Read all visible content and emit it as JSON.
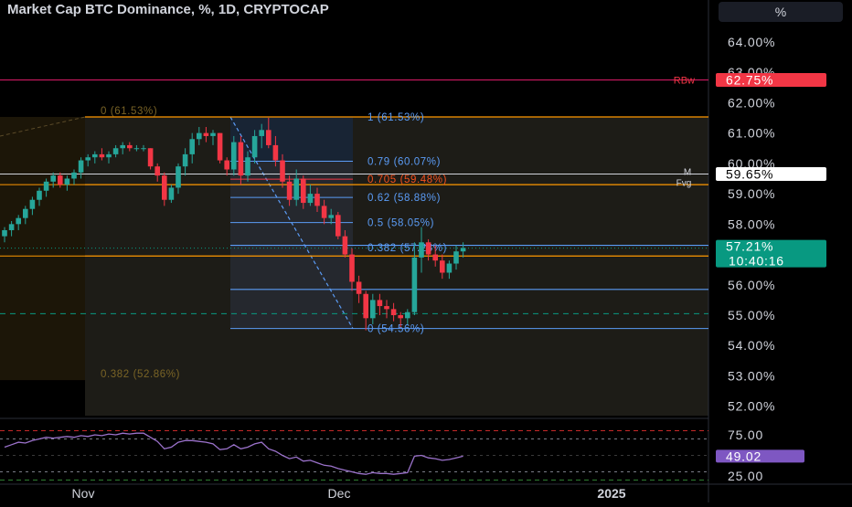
{
  "header": {
    "title": "Market Cap BTC Dominance, %, 1D, CRYPTOCAP",
    "unit_button": "%"
  },
  "colors": {
    "up": "#26a69a",
    "down": "#f23645",
    "fib_blue": "#5b9cf6",
    "fib_orange": "#ff9800",
    "resistance_red": "#c2185b",
    "rsi_line": "#9b72cb",
    "price_tag": "#089981",
    "rsi_tag": "#7e57c2",
    "rbw_tag": "#f23645"
  },
  "chart_data": [
    {
      "type": "candlestick",
      "symbol": "Market Cap BTC Dominance",
      "interval": "1D",
      "ylim": [
        51.6,
        64.6
      ],
      "y_ticks": [
        "64.00%",
        "63.00%",
        "62.00%",
        "61.00%",
        "60.00%",
        "59.00%",
        "58.00%",
        "57.00%",
        "56.00%",
        "55.00%",
        "54.00%",
        "53.00%",
        "52.00%"
      ],
      "x_ticks": [
        "Nov",
        "Dec",
        "2025"
      ],
      "candles": [
        {
          "o": 57.6,
          "h": 57.9,
          "l": 57.4,
          "c": 57.8
        },
        {
          "o": 57.8,
          "h": 58.1,
          "l": 57.6,
          "c": 58.0
        },
        {
          "o": 58.0,
          "h": 58.3,
          "l": 57.8,
          "c": 58.2
        },
        {
          "o": 58.2,
          "h": 58.6,
          "l": 58.0,
          "c": 58.5
        },
        {
          "o": 58.5,
          "h": 58.9,
          "l": 58.3,
          "c": 58.8
        },
        {
          "o": 58.8,
          "h": 59.2,
          "l": 58.6,
          "c": 59.1
        },
        {
          "o": 59.1,
          "h": 59.5,
          "l": 58.9,
          "c": 59.4
        },
        {
          "o": 59.4,
          "h": 59.7,
          "l": 59.2,
          "c": 59.6
        },
        {
          "o": 59.6,
          "h": 59.7,
          "l": 59.2,
          "c": 59.3
        },
        {
          "o": 59.3,
          "h": 59.6,
          "l": 59.1,
          "c": 59.5
        },
        {
          "o": 59.5,
          "h": 59.8,
          "l": 59.3,
          "c": 59.7
        },
        {
          "o": 59.7,
          "h": 60.2,
          "l": 59.5,
          "c": 60.1
        },
        {
          "o": 60.1,
          "h": 60.3,
          "l": 59.9,
          "c": 60.2
        },
        {
          "o": 60.2,
          "h": 60.4,
          "l": 60.0,
          "c": 60.3
        },
        {
          "o": 60.3,
          "h": 60.5,
          "l": 60.1,
          "c": 60.2
        },
        {
          "o": 60.2,
          "h": 60.4,
          "l": 60.0,
          "c": 60.3
        },
        {
          "o": 60.3,
          "h": 60.6,
          "l": 60.2,
          "c": 60.5
        },
        {
          "o": 60.5,
          "h": 60.7,
          "l": 60.3,
          "c": 60.6
        },
        {
          "o": 60.6,
          "h": 60.7,
          "l": 60.4,
          "c": 60.5
        },
        {
          "o": 60.5,
          "h": 60.6,
          "l": 60.4,
          "c": 60.5
        },
        {
          "o": 60.5,
          "h": 60.6,
          "l": 60.4,
          "c": 60.5
        },
        {
          "o": 60.5,
          "h": 60.5,
          "l": 59.8,
          "c": 59.9
        },
        {
          "o": 59.9,
          "h": 60.0,
          "l": 59.4,
          "c": 59.6
        },
        {
          "o": 59.6,
          "h": 59.7,
          "l": 58.6,
          "c": 58.8
        },
        {
          "o": 58.8,
          "h": 59.3,
          "l": 58.7,
          "c": 59.2
        },
        {
          "o": 59.2,
          "h": 60.0,
          "l": 59.0,
          "c": 59.9
        },
        {
          "o": 59.9,
          "h": 60.5,
          "l": 59.6,
          "c": 60.3
        },
        {
          "o": 60.3,
          "h": 61.0,
          "l": 60.0,
          "c": 60.8
        },
        {
          "o": 60.8,
          "h": 61.2,
          "l": 60.6,
          "c": 61.0
        },
        {
          "o": 61.0,
          "h": 61.2,
          "l": 60.7,
          "c": 60.9
        },
        {
          "o": 60.9,
          "h": 61.1,
          "l": 60.6,
          "c": 61.0
        },
        {
          "o": 61.0,
          "h": 61.0,
          "l": 60.0,
          "c": 60.1
        },
        {
          "o": 60.1,
          "h": 60.2,
          "l": 59.6,
          "c": 59.8
        },
        {
          "o": 59.8,
          "h": 60.9,
          "l": 59.6,
          "c": 60.7
        },
        {
          "o": 60.7,
          "h": 60.9,
          "l": 59.3,
          "c": 59.6
        },
        {
          "o": 59.6,
          "h": 60.4,
          "l": 59.4,
          "c": 60.2
        },
        {
          "o": 60.2,
          "h": 61.1,
          "l": 60.0,
          "c": 60.9
        },
        {
          "o": 60.9,
          "h": 61.3,
          "l": 60.5,
          "c": 61.1
        },
        {
          "o": 61.1,
          "h": 61.5,
          "l": 60.5,
          "c": 60.6
        },
        {
          "o": 60.6,
          "h": 60.9,
          "l": 59.9,
          "c": 60.1
        },
        {
          "o": 60.1,
          "h": 60.3,
          "l": 59.2,
          "c": 59.4
        },
        {
          "o": 59.4,
          "h": 59.6,
          "l": 58.6,
          "c": 58.8
        },
        {
          "o": 58.8,
          "h": 59.8,
          "l": 58.6,
          "c": 59.5
        },
        {
          "o": 59.5,
          "h": 59.6,
          "l": 58.5,
          "c": 58.7
        },
        {
          "o": 58.7,
          "h": 59.3,
          "l": 58.6,
          "c": 59.0
        },
        {
          "o": 59.0,
          "h": 59.2,
          "l": 58.4,
          "c": 58.6
        },
        {
          "o": 58.6,
          "h": 58.8,
          "l": 58.0,
          "c": 58.2
        },
        {
          "o": 58.2,
          "h": 58.5,
          "l": 58.0,
          "c": 58.3
        },
        {
          "o": 58.3,
          "h": 58.4,
          "l": 57.5,
          "c": 57.6
        },
        {
          "o": 57.6,
          "h": 57.8,
          "l": 56.9,
          "c": 57.0
        },
        {
          "o": 57.0,
          "h": 57.2,
          "l": 55.8,
          "c": 56.1
        },
        {
          "o": 56.1,
          "h": 56.3,
          "l": 55.4,
          "c": 55.7
        },
        {
          "o": 55.7,
          "h": 55.8,
          "l": 54.5,
          "c": 54.9
        },
        {
          "o": 54.9,
          "h": 55.7,
          "l": 54.7,
          "c": 55.5
        },
        {
          "o": 55.5,
          "h": 55.7,
          "l": 55.0,
          "c": 55.3
        },
        {
          "o": 55.3,
          "h": 55.5,
          "l": 54.9,
          "c": 55.2
        },
        {
          "o": 55.2,
          "h": 55.4,
          "l": 54.8,
          "c": 55.0
        },
        {
          "o": 55.0,
          "h": 55.1,
          "l": 54.6,
          "c": 54.9
        },
        {
          "o": 54.9,
          "h": 55.2,
          "l": 54.7,
          "c": 55.1
        },
        {
          "o": 55.1,
          "h": 57.4,
          "l": 55.0,
          "c": 56.9
        },
        {
          "o": 56.9,
          "h": 57.9,
          "l": 56.4,
          "c": 57.4
        },
        {
          "o": 57.4,
          "h": 57.5,
          "l": 56.8,
          "c": 57.0
        },
        {
          "o": 57.0,
          "h": 57.3,
          "l": 56.6,
          "c": 56.8
        },
        {
          "o": 56.8,
          "h": 57.0,
          "l": 56.2,
          "c": 56.4
        },
        {
          "o": 56.4,
          "h": 56.8,
          "l": 56.2,
          "c": 56.7
        },
        {
          "o": 56.7,
          "h": 57.3,
          "l": 56.5,
          "c": 57.1
        },
        {
          "o": 57.1,
          "h": 57.4,
          "l": 56.9,
          "c": 57.21
        }
      ],
      "last_price": "57.21%",
      "countdown": "10:40:16",
      "resistance": {
        "label": "RBw",
        "value": 62.75,
        "tag": "62.75%"
      },
      "marker_level": {
        "value": 59.65,
        "tag": "59.65%",
        "labels": [
          "M",
          "Fvg"
        ]
      },
      "fib_up": [
        {
          "label": "1 (61.53%)",
          "value": 61.53
        },
        {
          "label": "0.79 (60.07%)",
          "value": 60.07
        },
        {
          "label": "0.705 (59.48%)",
          "value": 59.48
        },
        {
          "label": "0.62 (58.88%)",
          "value": 58.88
        },
        {
          "label": "0.5 (58.05%)",
          "value": 58.05
        },
        {
          "label": "0.382 (57.23%)",
          "value": 57.23
        },
        {
          "label": "0 (54.56%)",
          "value": 54.56
        }
      ],
      "fib_outer": [
        {
          "label": "0 (61.53%)",
          "value": 61.53
        },
        {
          "label": "0.382 (52.86%)",
          "value": 52.86
        }
      ],
      "orange_levels": [
        61.53,
        59.3,
        56.95
      ],
      "blue_levels": [
        57.3,
        55.85,
        54.56
      ],
      "dashed_level": 55.05
    },
    {
      "type": "line",
      "name": "RSI",
      "ylim": [
        15,
        95
      ],
      "y_ticks": [
        "75.00",
        "25.00"
      ],
      "bands": [
        80,
        70,
        50,
        30,
        20
      ],
      "last_value": "49.02",
      "values": [
        60,
        63,
        66,
        65,
        68,
        70,
        72,
        71,
        72,
        73,
        72,
        74,
        73,
        75,
        74,
        76,
        75,
        77,
        76,
        77,
        77,
        72,
        67,
        58,
        60,
        66,
        68,
        68,
        67,
        66,
        64,
        57,
        58,
        63,
        58,
        60,
        64,
        66,
        58,
        55,
        50,
        46,
        48,
        43,
        44,
        41,
        38,
        37,
        34,
        32,
        30,
        28,
        27,
        29,
        28,
        28,
        27,
        28,
        29,
        49,
        50,
        47,
        46,
        44,
        45,
        47,
        49.02
      ]
    }
  ]
}
